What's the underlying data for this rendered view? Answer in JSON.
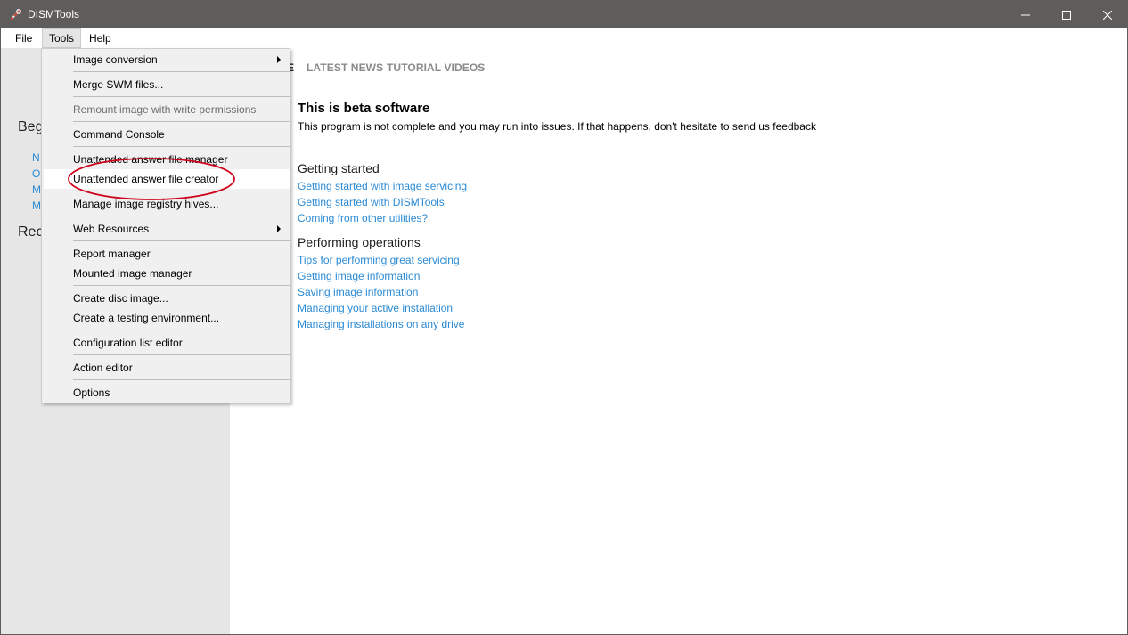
{
  "window": {
    "title": "DISMTools",
    "icon": "dismtools-tools-icon",
    "controls": [
      "minimize-icon",
      "maximize-icon",
      "close-icon"
    ]
  },
  "menubar": {
    "file": "File",
    "tools": "Tools",
    "help": "Help"
  },
  "left_pane": {
    "heading_begin": "Beg",
    "links": [
      "N",
      "O",
      "M",
      "M"
    ],
    "heading_recent": "Rec"
  },
  "main": {
    "tabs": [
      "E",
      "LATEST NEWS",
      "TUTORIAL VIDEOS"
    ],
    "beta_title": "This is beta software",
    "beta_desc": "This program is not complete and you may run into issues. If that happens, don't hesitate to send us feedback",
    "getting_started": {
      "heading": "Getting started",
      "links": [
        "Getting started with image servicing",
        "Getting started with DISMTools",
        "Coming from other utilities?"
      ]
    },
    "performing_operations": {
      "heading": "Performing operations",
      "links": [
        "Tips for performing great servicing",
        "Getting image information",
        "Saving image information",
        "Managing your active installation",
        "Managing installations on any drive"
      ]
    }
  },
  "tools_menu": {
    "items": [
      {
        "label": "Image conversion",
        "submenu": true
      },
      {
        "label": "Merge SWM files..."
      },
      {
        "label": "Remount image with write permissions",
        "disabled": true
      },
      {
        "label": "Command Console"
      },
      {
        "label": "Unattended answer file manager"
      },
      {
        "label": "Unattended answer file creator",
        "highlighted": true
      },
      {
        "label": "Manage image registry hives..."
      },
      {
        "label": "Web Resources",
        "submenu": true
      },
      {
        "label": "Report manager"
      },
      {
        "label": "Mounted image manager"
      },
      {
        "label": "Create disc image..."
      },
      {
        "label": "Create a testing environment..."
      },
      {
        "label": "Configuration list editor"
      },
      {
        "label": "Action editor"
      },
      {
        "label": "Options"
      }
    ]
  },
  "colors": {
    "titlebar": "#5f5d5b",
    "link": "#2a8ad4",
    "left_pane": "#e6e6e6",
    "menu_bg": "#f0f0f0",
    "annotation": "#d0021b"
  }
}
